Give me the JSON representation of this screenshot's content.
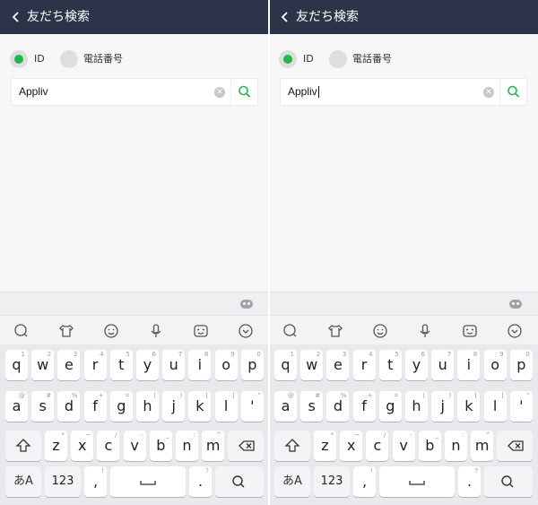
{
  "header": {
    "title": "友だち検索"
  },
  "radio": {
    "id_label": "ID",
    "phone_label": "電話番号"
  },
  "search": {
    "value": "Appliv",
    "placeholder": ""
  },
  "keyboard": {
    "row1": [
      {
        "char": "q",
        "sub": "1"
      },
      {
        "char": "w",
        "sub": "2"
      },
      {
        "char": "e",
        "sub": "3"
      },
      {
        "char": "r",
        "sub": "4"
      },
      {
        "char": "t",
        "sub": "5"
      },
      {
        "char": "y",
        "sub": "6"
      },
      {
        "char": "u",
        "sub": "7"
      },
      {
        "char": "i",
        "sub": "8"
      },
      {
        "char": "o",
        "sub": "9"
      },
      {
        "char": "p",
        "sub": "0"
      }
    ],
    "row2": [
      {
        "char": "a",
        "sub": "@"
      },
      {
        "char": "s",
        "sub": "#"
      },
      {
        "char": "d",
        "sub": "%"
      },
      {
        "char": "f",
        "sub": "+"
      },
      {
        "char": "g",
        "sub": "="
      },
      {
        "char": "h",
        "sub": "("
      },
      {
        "char": "j",
        "sub": ")"
      },
      {
        "char": "k",
        "sub": "["
      },
      {
        "char": "l",
        "sub": "]"
      },
      {
        "char": "'",
        "sub": "\""
      }
    ],
    "row3": [
      {
        "char": "z",
        "sub": "*"
      },
      {
        "char": "x",
        "sub": "~"
      },
      {
        "char": "c",
        "sub": "/"
      },
      {
        "char": "v",
        "sub": "-"
      },
      {
        "char": "b",
        "sub": "_"
      },
      {
        "char": "n",
        "sub": ":"
      },
      {
        "char": "m",
        "sub": "^"
      }
    ],
    "mode_label": "あA",
    "numbers_label": "123",
    "comma": ",",
    "comma_sub": "!",
    "period": ".",
    "period_sub": "?"
  },
  "colors": {
    "header_bg": "#2d3449",
    "accent_green": "#20b94c"
  }
}
